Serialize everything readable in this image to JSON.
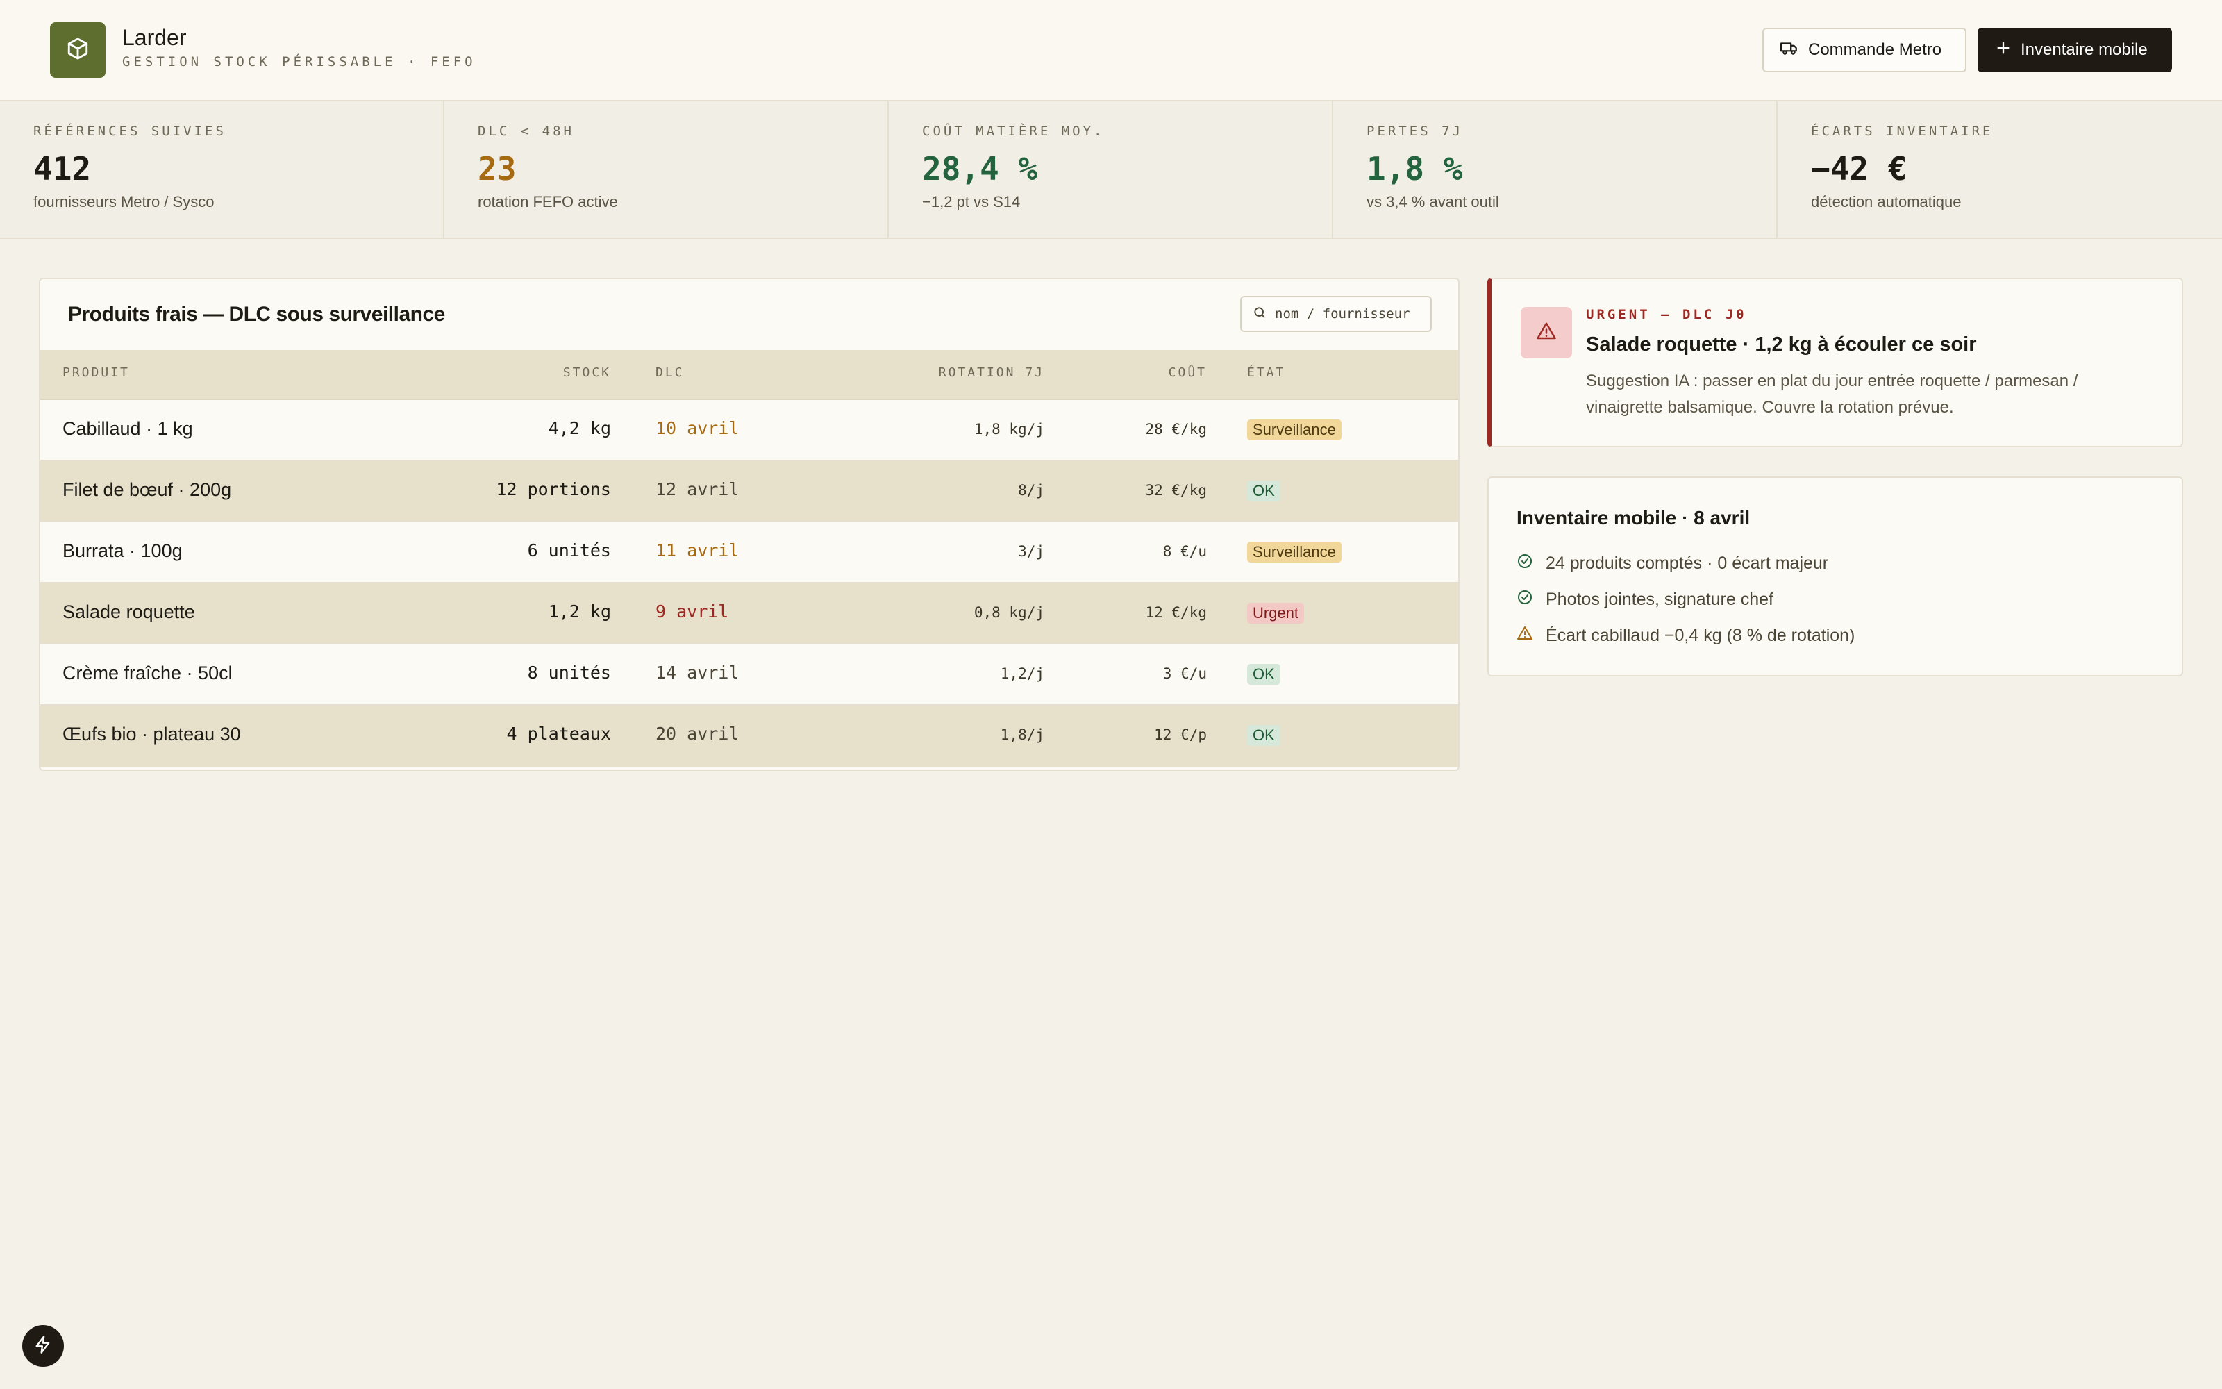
{
  "app": {
    "title": "Larder",
    "subtitle": "GESTION STOCK PÉRISSABLE · FEFO",
    "logo_icon": "box-icon",
    "brand_color": "#5d6e2f"
  },
  "toolbar": {
    "order_label": "Commande Metro",
    "order_icon": "truck-icon",
    "inventory_label": "Inventaire mobile",
    "inventory_icon": "plus-icon"
  },
  "kpis": [
    {
      "label": "RÉFÉRENCES SUIVIES",
      "value": "412",
      "note": "fournisseurs Metro / Sysco",
      "color": "#1e1b15"
    },
    {
      "label": "DLC < 48H",
      "value": "23",
      "note": "rotation FEFO active",
      "color": "#a66a12"
    },
    {
      "label": "COÛT MATIÈRE MOY.",
      "value": "28,4 %",
      "note": "−1,2 pt vs S14",
      "color": "#23633d"
    },
    {
      "label": "PERTES 7J",
      "value": "1,8 %",
      "note": "vs 3,4 % avant outil",
      "color": "#23633d"
    },
    {
      "label": "ÉCARTS INVENTAIRE",
      "value": "−42 €",
      "note": "détection automatique",
      "color": "#1e1b15"
    }
  ],
  "table": {
    "title": "Produits frais — DLC sous surveillance",
    "search_placeholder": "nom / fournisseur",
    "headers": {
      "product": "PRODUIT",
      "stock": "STOCK",
      "dlc": "DLC",
      "rotation": "ROTATION 7J",
      "cost": "COÛT",
      "state": "ÉTAT"
    },
    "rows": [
      {
        "name": "Cabillaud · 1 kg",
        "stock": "4,2 kg",
        "dlc": "10 avril",
        "dlc_color": "#a66a12",
        "rotation": "1,8 kg/j",
        "cost": "28 €/kg",
        "state": "Surveillance",
        "state_kind": "watch"
      },
      {
        "name": "Filet de bœuf · 200g",
        "stock": "12 portions",
        "dlc": "12 avril",
        "dlc_color": "#4a4536",
        "rotation": "8/j",
        "cost": "32 €/kg",
        "state": "OK",
        "state_kind": "ok"
      },
      {
        "name": "Burrata · 100g",
        "stock": "6 unités",
        "dlc": "11 avril",
        "dlc_color": "#a66a12",
        "rotation": "3/j",
        "cost": "8 €/u",
        "state": "Surveillance",
        "state_kind": "watch"
      },
      {
        "name": "Salade roquette",
        "stock": "1,2 kg",
        "dlc": "9 avril",
        "dlc_color": "#9c2a22",
        "rotation": "0,8 kg/j",
        "cost": "12 €/kg",
        "state": "Urgent",
        "state_kind": "urgent"
      },
      {
        "name": "Crème fraîche · 50cl",
        "stock": "8 unités",
        "dlc": "14 avril",
        "dlc_color": "#4a4536",
        "rotation": "1,2/j",
        "cost": "3 €/u",
        "state": "OK",
        "state_kind": "ok"
      },
      {
        "name": "Œufs bio · plateau 30",
        "stock": "4 plateaux",
        "dlc": "20 avril",
        "dlc_color": "#4a4536",
        "rotation": "1,8/j",
        "cost": "12 €/p",
        "state": "OK",
        "state_kind": "ok"
      }
    ]
  },
  "urgent": {
    "tag": "URGENT — DLC J0",
    "title": "Salade roquette · 1,2 kg à écouler ce soir",
    "text": "Suggestion IA : passer en plat du jour entrée roquette / parmesan / vinaigrette balsamique. Couvre la rotation prévue.",
    "icon": "warning-icon"
  },
  "inventory": {
    "title": "Inventaire mobile · 8 avril",
    "items": [
      {
        "text": "24 produits comptés · 0 écart majeur",
        "icon": "check-circle-icon",
        "color": "#23633d"
      },
      {
        "text": "Photos jointes, signature chef",
        "icon": "check-circle-icon",
        "color": "#23633d"
      },
      {
        "text": "Écart cabillaud −0,4 kg (8 % de rotation)",
        "icon": "warning-icon",
        "color": "#a66a12"
      }
    ]
  }
}
